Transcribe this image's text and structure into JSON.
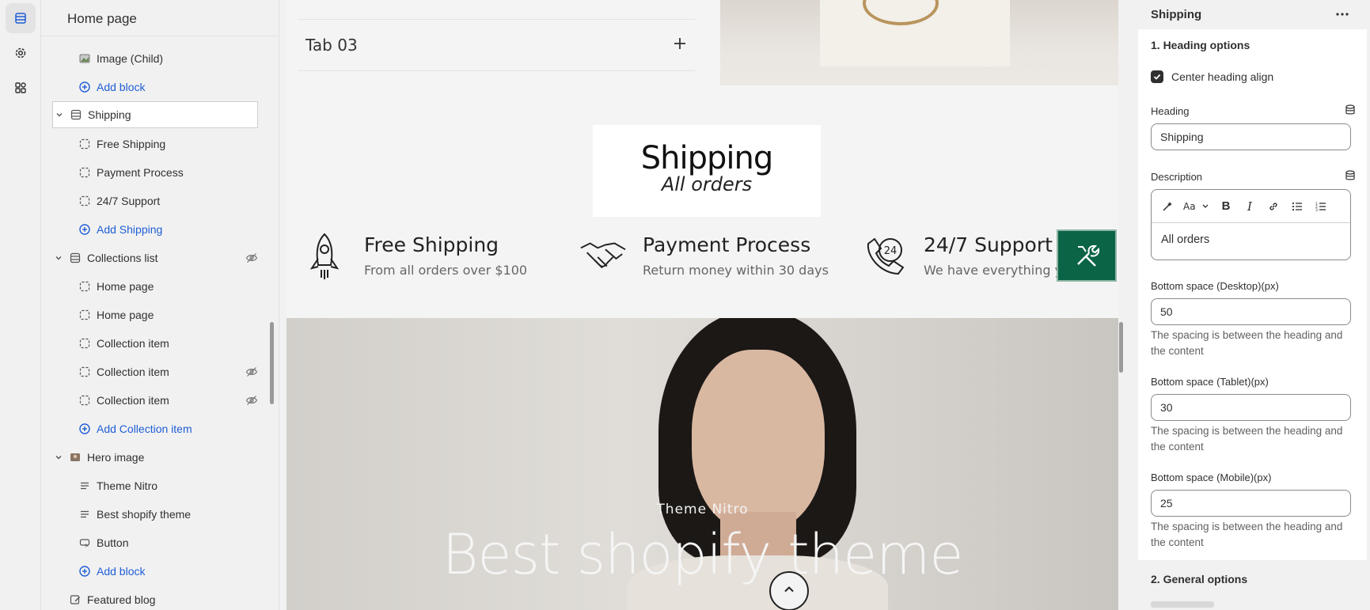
{
  "rail": {
    "items": [
      {
        "name": "sections-icon",
        "active": true
      },
      {
        "name": "settings-icon",
        "active": false
      },
      {
        "name": "apps-icon",
        "active": false
      }
    ]
  },
  "sidebar": {
    "title": "Home page",
    "items": [
      {
        "label": "Image (Child)",
        "type": "child",
        "icon": "image-icon"
      },
      {
        "label": "Add block",
        "type": "add-child"
      },
      {
        "label": "Shipping",
        "type": "section",
        "icon": "section-icon",
        "selected": true
      },
      {
        "label": "Free Shipping",
        "type": "child",
        "icon": "block-icon"
      },
      {
        "label": "Payment Process",
        "type": "child",
        "icon": "block-icon"
      },
      {
        "label": "24/7 Support",
        "type": "child",
        "icon": "block-icon"
      },
      {
        "label": "Add Shipping",
        "type": "add-child"
      },
      {
        "label": "Collections list",
        "type": "section",
        "icon": "section-icon",
        "hidden": true
      },
      {
        "label": "Home page",
        "type": "child",
        "icon": "block-icon"
      },
      {
        "label": "Home page",
        "type": "child",
        "icon": "block-icon"
      },
      {
        "label": "Collection item",
        "type": "child",
        "icon": "block-icon"
      },
      {
        "label": "Collection item",
        "type": "child",
        "icon": "block-icon",
        "hidden": true
      },
      {
        "label": "Collection item",
        "type": "child",
        "icon": "block-icon",
        "hidden": true
      },
      {
        "label": "Add Collection item",
        "type": "add-child"
      },
      {
        "label": "Hero image",
        "type": "section",
        "icon": "hero-image-icon"
      },
      {
        "label": "Theme Nitro",
        "type": "child",
        "icon": "text-icon"
      },
      {
        "label": "Best shopify theme",
        "type": "child",
        "icon": "text-icon"
      },
      {
        "label": "Button",
        "type": "child",
        "icon": "button-icon"
      },
      {
        "label": "Add block",
        "type": "add-child"
      },
      {
        "label": "Featured blog",
        "type": "section-leaf",
        "icon": "blog-icon"
      }
    ]
  },
  "preview": {
    "tab_title": "Tab 03",
    "shipping_heading": "Shipping",
    "shipping_sub": "All orders",
    "features": [
      {
        "title": "Free Shipping",
        "desc": "From all orders over $100",
        "icon": "rocket-icon"
      },
      {
        "title": "Payment Process",
        "desc": "Return money within 30 days",
        "icon": "handshake-icon"
      },
      {
        "title": "24/7 Support",
        "desc": "We have everything you",
        "icon": "support-24-icon"
      }
    ],
    "hero_sub": "Theme Nitro",
    "hero_title": "Best shopify theme"
  },
  "panel": {
    "title": "Shipping",
    "section_heading_1": "1. Heading options",
    "center_align_label": "Center heading align",
    "center_align_checked": true,
    "heading_label": "Heading",
    "heading_value": "Shipping",
    "description_label": "Description",
    "description_value": "All orders",
    "bottom_desktop_label": "Bottom space (Desktop)(px)",
    "bottom_desktop_value": "50",
    "bottom_tablet_label": "Bottom space (Tablet)(px)",
    "bottom_tablet_value": "30",
    "bottom_mobile_label": "Bottom space (Mobile)(px)",
    "bottom_mobile_value": "25",
    "help_text": "The spacing is between the heading and the content",
    "section_heading_2": "2. General options"
  },
  "colors": {
    "accent_link": "#1f5ed6",
    "badge_green": "#0b6446"
  }
}
